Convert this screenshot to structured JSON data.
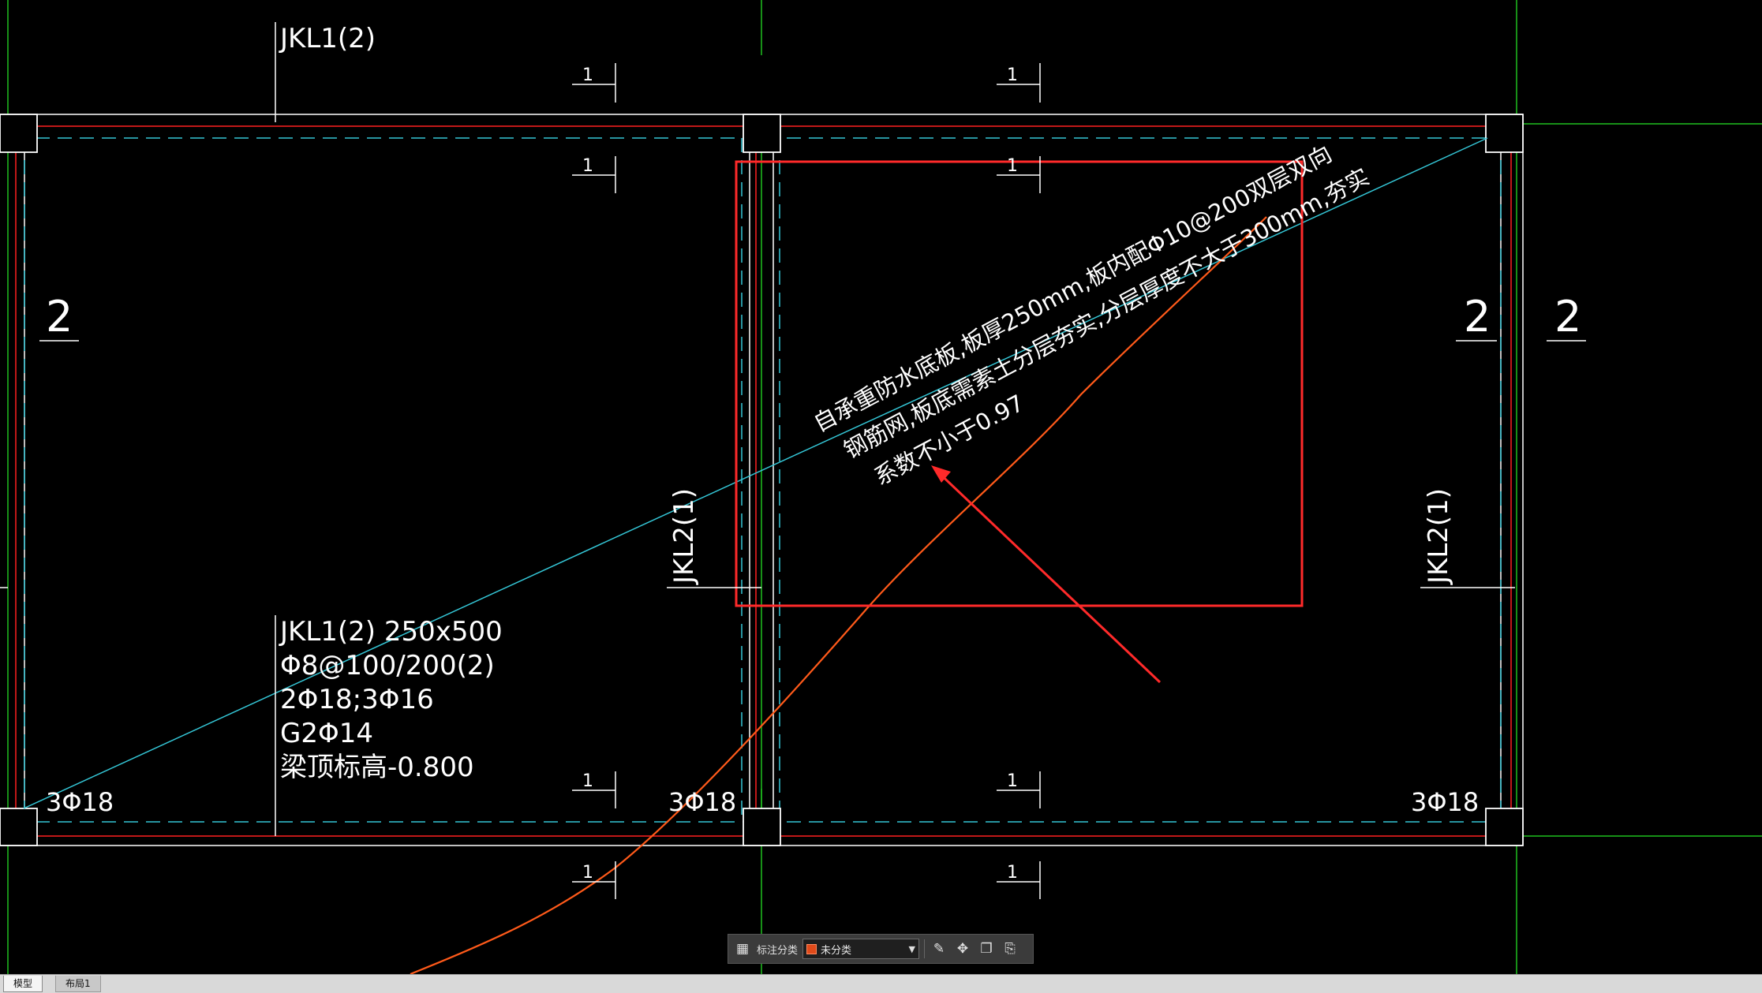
{
  "drawing": {
    "beam_labels": {
      "top_beam": "JKL1(2)",
      "left_beam_col": "JKL2(1)",
      "right_beam_col": "JKL2(1)"
    },
    "axis_marks": {
      "left": "2",
      "right_inner": "2",
      "right_outer": "2"
    },
    "section_marks": [
      "1",
      "1",
      "1",
      "1",
      "1",
      "1",
      "1",
      "1"
    ],
    "rebar_labels": {
      "bottom_left": "3Φ18",
      "bottom_mid": "3Φ18",
      "bottom_right": "3Φ18"
    },
    "beam_spec": {
      "line1": "JKL1(2) 250x500",
      "line2": "Φ8@100/200(2)",
      "line3": "2Φ18;3Φ16",
      "line4": "G2Φ14",
      "line5": "梁顶标高-0.800"
    },
    "annotation": {
      "line1": "自承重防水底板,板厚250mm,板内配Φ10@200双层双向",
      "line2": "钢筋网,板底需素土分层夯实,分层厚度不大于300mm,夯实",
      "line3": "系数不小于0.97"
    },
    "colors": {
      "background": "#000000",
      "frame_white": "#ffffff",
      "beam_red": "#ff2020",
      "dash_cyan": "#34c6d6",
      "grid_green": "#1fbf1f",
      "markup_red": "#ff2a2a",
      "curve_orange": "#ff5a1a"
    }
  },
  "toolbar": {
    "grid_icon": "grid-icon",
    "label": "标注分类",
    "category_value": "未分类",
    "category_color": "#e04a1a",
    "icons": [
      "edit-icon",
      "move-icon",
      "copy-icon",
      "paste-icon"
    ]
  },
  "tabs": {
    "model": "模型",
    "layout1": "布局1"
  }
}
